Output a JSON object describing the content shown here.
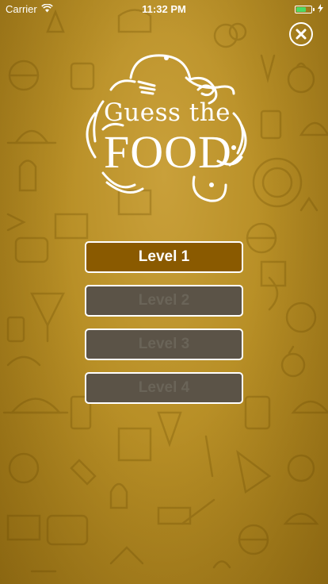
{
  "status_bar": {
    "carrier": "Carrier",
    "time": "11:32 PM",
    "wifi_icon": "wifi-icon",
    "battery_icon": "battery-icon",
    "charging_icon": "lightning-icon"
  },
  "header": {
    "close_icon": "close-icon"
  },
  "logo": {
    "line1": "Guess the",
    "line2": "FOOD"
  },
  "levels": [
    {
      "label": "Level 1",
      "state": "unlocked"
    },
    {
      "label": "Level 2",
      "state": "locked"
    },
    {
      "label": "Level 3",
      "state": "locked"
    },
    {
      "label": "Level 4",
      "state": "locked"
    }
  ],
  "colors": {
    "background": "#b88f26",
    "unlocked_button": "#8a5a00",
    "locked_button": "#5b5347",
    "battery": "#4cd964"
  }
}
